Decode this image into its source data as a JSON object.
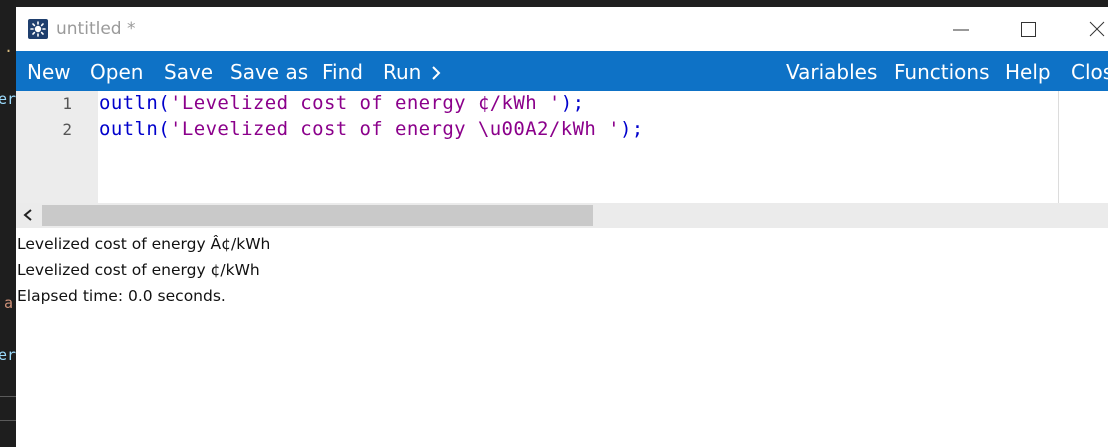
{
  "background_editor": {
    "glyphs": [
      ".",
      "er",
      "a",
      "er"
    ]
  },
  "window": {
    "title": "untitled *",
    "app_icon": "gear-sun-icon",
    "controls": {
      "minimize": "minimize-icon",
      "maximize": "maximize-icon",
      "close": "close-icon"
    }
  },
  "menubar": {
    "accent": "#0e72c6",
    "left_items": [
      "New",
      "Open",
      "Save",
      "Save as",
      "Find",
      "Run"
    ],
    "run_chevron": "chevron-right-icon",
    "right_items": [
      "Variables",
      "Functions",
      "Help",
      "Clos"
    ]
  },
  "editor": {
    "lines": [
      {
        "number": "1",
        "fn": "outln(",
        "str": "'Levelized cost of energy ¢/kWh '",
        "end": ");"
      },
      {
        "number": "2",
        "fn": "outln(",
        "str": "'Levelized cost of energy \\u00A2/kWh '",
        "end": ");"
      }
    ]
  },
  "scrollbar": {
    "left_arrow": "chevron-left-icon"
  },
  "output": {
    "lines": [
      "Levelized cost of energy Â¢/kWh",
      "Levelized cost of energy ¢/kWh",
      "Elapsed time: 0.0 seconds."
    ]
  }
}
